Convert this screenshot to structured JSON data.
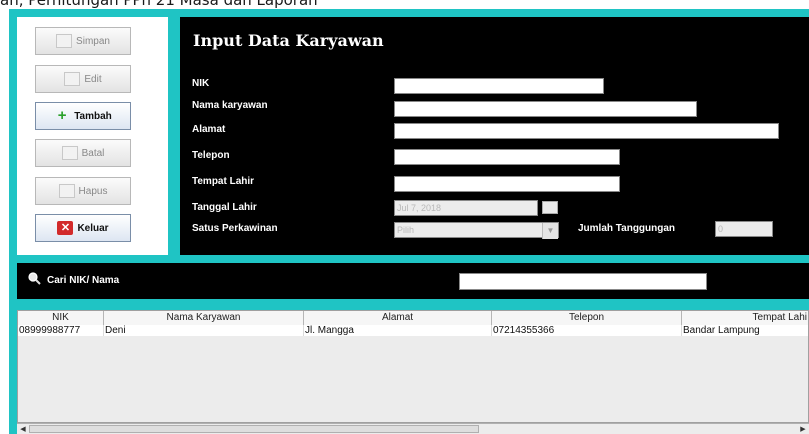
{
  "window": {
    "caption": "an, Perhitungan PPh 21 Masa dan Laporan"
  },
  "buttons": {
    "simpan": "Simpan",
    "edit": "Edit",
    "tambah": "Tambah",
    "batal": "Batal",
    "hapus": "Hapus",
    "keluar": "Keluar"
  },
  "form": {
    "title": "Input Data Karyawan",
    "nik_label": "NIK",
    "nama_label": "Nama karyawan",
    "alamat_label": "Alamat",
    "telepon_label": "Telepon",
    "tempat_lahir_label": "Tempat Lahir",
    "tanggal_lahir_label": "Tanggal Lahir",
    "tanggal_lahir_value": "Jul 7, 2018",
    "status_label": "Satus Perkawinan",
    "status_value": "Pilih",
    "tanggungan_label": "Jumlah Tanggungan",
    "tanggungan_value": "0"
  },
  "search": {
    "label": "Cari NIK/ Nama",
    "value": ""
  },
  "table": {
    "columns": [
      "NIK",
      "Nama Karyawan",
      "Alamat",
      "Telepon",
      "Tempat Lahi"
    ],
    "rows": [
      [
        "08999988777",
        "Deni",
        "Jl. Mangga",
        "07214355366",
        "Bandar Lampung"
      ]
    ]
  }
}
